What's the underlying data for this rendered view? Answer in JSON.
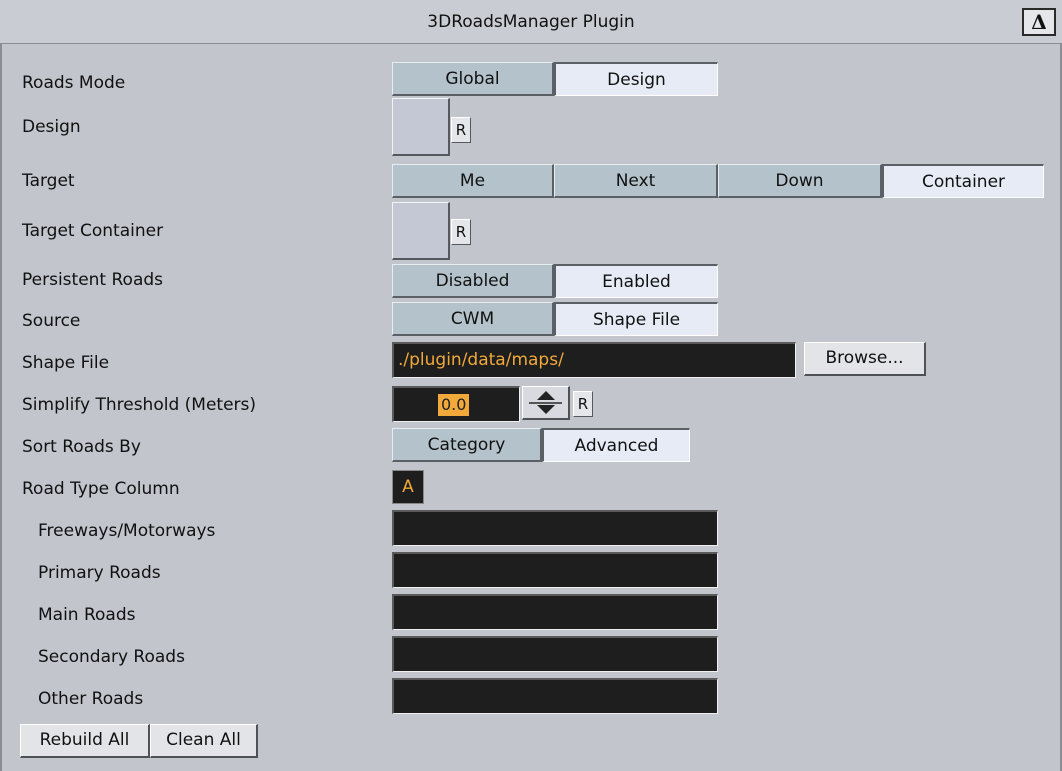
{
  "window": {
    "title": "3DRoadsManager Plugin",
    "logo_icon": "vizrt-logo-icon",
    "logo_text": "Δ"
  },
  "rows": {
    "roads_mode": {
      "label": "Roads Mode",
      "options": [
        "Global",
        "Design"
      ],
      "selected": "Design"
    },
    "design": {
      "label": "Design",
      "reset": "R"
    },
    "target": {
      "label": "Target",
      "options": [
        "Me",
        "Next",
        "Down",
        "Container"
      ],
      "selected": "Container"
    },
    "target_container": {
      "label": "Target Container",
      "reset": "R"
    },
    "persistent_roads": {
      "label": "Persistent Roads",
      "options": [
        "Disabled",
        "Enabled"
      ],
      "selected": "Enabled"
    },
    "source": {
      "label": "Source",
      "options": [
        "CWM",
        "Shape File"
      ],
      "selected": "Shape File"
    },
    "shape_file": {
      "label": "Shape File",
      "value": "./plugin/data/maps/",
      "browse": "Browse..."
    },
    "simplify": {
      "label": "Simplify Threshold (Meters)",
      "value": "0.0",
      "reset": "R"
    },
    "sort_by": {
      "label": "Sort Roads By",
      "options": [
        "Category",
        "Advanced"
      ],
      "selected": "Advanced"
    },
    "road_type_column": {
      "label": "Road Type Column",
      "value": "A"
    },
    "categories": [
      {
        "label": "Freeways/Motorways",
        "value": ""
      },
      {
        "label": "Primary Roads",
        "value": ""
      },
      {
        "label": "Main Roads",
        "value": ""
      },
      {
        "label": "Secondary Roads",
        "value": ""
      },
      {
        "label": "Other Roads",
        "value": ""
      }
    ]
  },
  "footer": {
    "rebuild": "Rebuild All",
    "clean": "Clean All"
  },
  "colors": {
    "background": "#c2c5cc",
    "field": "#1e1e1e",
    "accent": "#f0a93a",
    "seg_off": "#b4c3cb",
    "seg_on": "#e6ebf6"
  }
}
